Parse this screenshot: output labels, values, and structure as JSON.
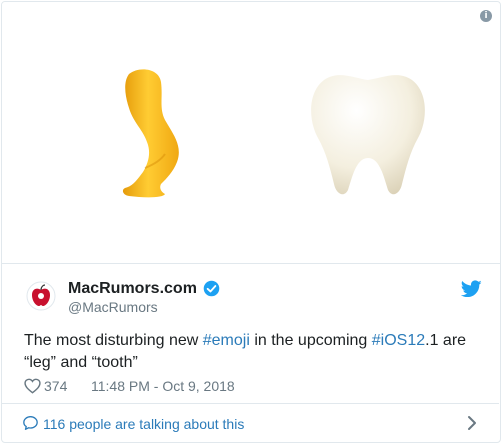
{
  "media": {
    "info_glyph": "i",
    "emoji": [
      "leg-emoji",
      "tooth-emoji"
    ]
  },
  "author": {
    "name": "MacRumors.com",
    "handle": "@MacRumors",
    "verified": true
  },
  "tweet": {
    "text_1": "The most disturbing new ",
    "hashtag_1": "#emoji",
    "text_2": " in the upcoming ",
    "hashtag_2": "#iOS12",
    "text_3": ".1 are",
    "text_4": "“leg” and “tooth”"
  },
  "meta": {
    "like_count": "374",
    "timestamp": "11:48 PM - Oct 9, 2018"
  },
  "footer": {
    "talking_label": "116 people are talking about this"
  },
  "colors": {
    "link": "#2b7bb9",
    "muted": "#697882",
    "border": "#e1e8ed",
    "verified": "#1da1f2",
    "twitter_blue": "#1da1f2"
  }
}
